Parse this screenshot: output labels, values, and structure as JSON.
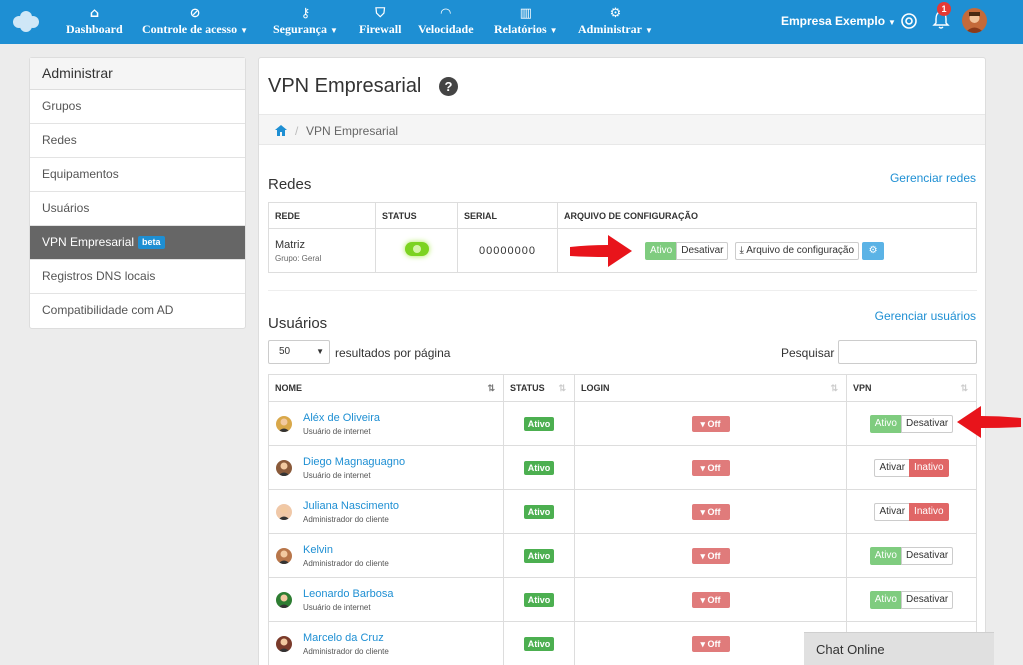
{
  "nav": {
    "items": [
      {
        "label": "Dashboard",
        "caret": false
      },
      {
        "label": "Controle de acesso",
        "caret": true
      },
      {
        "label": "Segurança",
        "caret": true
      },
      {
        "label": "Firewall",
        "caret": false
      },
      {
        "label": "Velocidade",
        "caret": false
      },
      {
        "label": "Relatórios",
        "caret": true
      },
      {
        "label": "Administrar",
        "caret": true
      }
    ],
    "company": "Empresa Exemplo",
    "notification_count": "1"
  },
  "sidebar": {
    "title": "Administrar",
    "items": [
      {
        "label": "Grupos"
      },
      {
        "label": "Redes"
      },
      {
        "label": "Equipamentos"
      },
      {
        "label": "Usuários"
      },
      {
        "label": "VPN Empresarial",
        "badge": "beta",
        "active": true
      },
      {
        "label": "Registros DNS locais"
      },
      {
        "label": "Compatibilidade com AD"
      }
    ]
  },
  "main": {
    "title": "VPN Empresarial",
    "help": "?",
    "breadcrumb": {
      "sep": "/",
      "current": "VPN Empresarial"
    }
  },
  "networks": {
    "title": "Redes",
    "manage_link": "Gerenciar redes",
    "headers": [
      "REDE",
      "STATUS",
      "SERIAL",
      "ARQUIVO DE CONFIGURAÇÃO"
    ],
    "row": {
      "name": "Matriz",
      "group": "Grupo: Geral",
      "serial": "00000000",
      "active_label": "Ativo",
      "deactivate_label": "Desativar",
      "config_label": "Arquivo de configuração"
    }
  },
  "users": {
    "title": "Usuários",
    "manage_link": "Gerenciar usuários",
    "per_page": "50",
    "per_page_label": "resultados por página",
    "search_label": "Pesquisar",
    "headers": [
      "NOME",
      "STATUS",
      "LOGIN",
      "VPN"
    ],
    "rows": [
      {
        "name": "Aléx de Oliveira",
        "role": "Usuário de internet",
        "status": "Ativo",
        "login": "Off",
        "vpn_left": "Ativo",
        "vpn_right": "Desativar",
        "vpn_active": true
      },
      {
        "name": "Diego Magnaguagno",
        "role": "Usuário de internet",
        "status": "Ativo",
        "login": "Off",
        "vpn_left": "Ativar",
        "vpn_right": "Inativo",
        "vpn_active": false
      },
      {
        "name": "Juliana Nascimento",
        "role": "Administrador do cliente",
        "status": "Ativo",
        "login": "Off",
        "vpn_left": "Ativar",
        "vpn_right": "Inativo",
        "vpn_active": false
      },
      {
        "name": "Kelvin",
        "role": "Administrador do cliente",
        "status": "Ativo",
        "login": "Off",
        "vpn_left": "Ativo",
        "vpn_right": "Desativar",
        "vpn_active": true
      },
      {
        "name": "Leonardo Barbosa",
        "role": "Usuário de internet",
        "status": "Ativo",
        "login": "Off",
        "vpn_left": "Ativo",
        "vpn_right": "Desativar",
        "vpn_active": true
      },
      {
        "name": "Marcelo da Cruz",
        "role": "Administrador do cliente",
        "status": "Ativo",
        "login": "Off",
        "vpn_left": "",
        "vpn_right": "",
        "vpn_active": true
      }
    ]
  },
  "chat": {
    "label": "Chat Online"
  },
  "colors": {
    "nav": "#1e8fd3",
    "link": "#1e8fd3",
    "active_green": "#7fcc7f",
    "inactive_red": "#e06666",
    "arrow": "#e8141b"
  }
}
